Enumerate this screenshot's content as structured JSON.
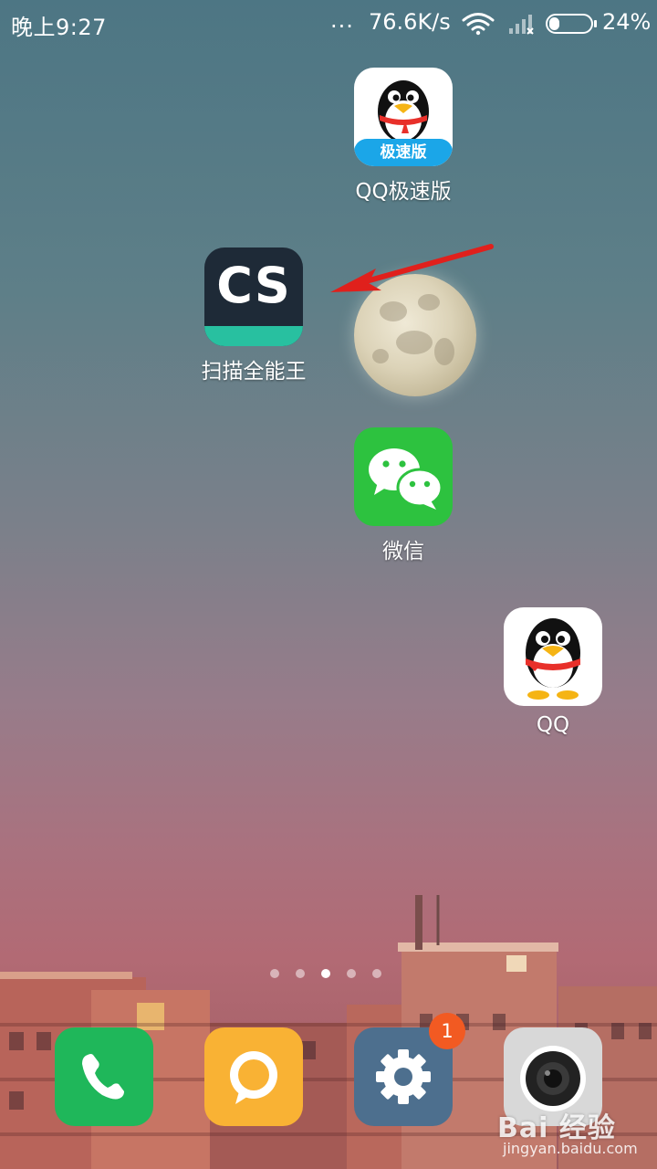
{
  "status_bar": {
    "time": "晚上9:27",
    "dots": "...",
    "net_speed": "76.6K/s",
    "battery_percent": "24%",
    "battery_level": 0.24,
    "wifi_icon": "wifi-icon",
    "signal_icon": "cellular-signal-icon"
  },
  "apps": {
    "qq_fast": {
      "label": "QQ极速版",
      "band_text": "极速版",
      "icon": "qq-penguin-icon"
    },
    "camscanner": {
      "label": "扫描全能王",
      "icon_text": "CS"
    },
    "wechat": {
      "label": "微信",
      "icon": "wechat-bubbles-icon"
    },
    "qq": {
      "label": "QQ",
      "icon": "qq-penguin-icon"
    }
  },
  "page_indicator": {
    "pages": 5,
    "current_index": 2
  },
  "dock": {
    "phone": {
      "icon": "phone-icon",
      "color": "#1fb75a"
    },
    "messages": {
      "icon": "message-icon",
      "color": "#f9b234"
    },
    "settings": {
      "icon": "gear-icon",
      "color": "#4d6f8e",
      "badge": "1"
    },
    "camera": {
      "icon": "camera-icon",
      "color": "#d8d8d8"
    }
  },
  "watermark": {
    "brand": "Bai 经验",
    "url": "jingyan.baidu.com"
  },
  "colors": {
    "arrow": "#e0201c",
    "badge": "#f25a22",
    "cs_accent": "#28c0a0"
  }
}
